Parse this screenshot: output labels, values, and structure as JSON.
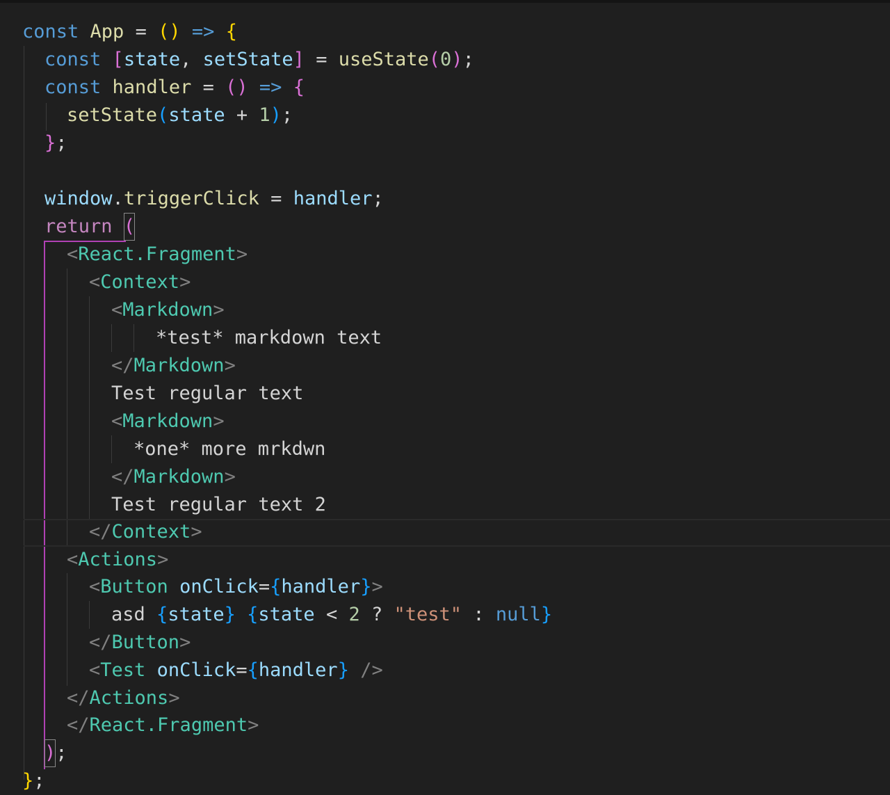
{
  "editor": {
    "language": "javascript-react",
    "theme": "dark",
    "lines": [
      "const App = () => {",
      "  const [state, setState] = useState(0);",
      "  const handler = () => {",
      "    setState(state + 1);",
      "  };",
      "",
      "  window.triggerClick = handler;",
      "  return (",
      "    <React.Fragment>",
      "      <Context>",
      "        <Markdown>",
      "            *test* markdown text",
      "        </Markdown>",
      "        Test regular text",
      "        <Markdown>",
      "          *one* more mrkdwn",
      "        </Markdown>",
      "        Test regular text 2",
      "      </Context>",
      "    <Actions>",
      "      <Button onClick={handler}>",
      "        asd {state} {state < 2 ? \"test\" : null}",
      "      </Button>",
      "      <Test onClick={handler} />",
      "    </Actions>",
      "    </React.Fragment>",
      "  );",
      "};"
    ]
  },
  "tokens": {
    "const": "const",
    "return": "return",
    "null": "null",
    "App": "App",
    "handler": "handler",
    "state": "state",
    "setState": "setState",
    "useState": "useState",
    "zero": "0",
    "one": "1",
    "two": "2",
    "window": "window",
    "triggerClick": "triggerClick",
    "ReactFragment": "React.Fragment",
    "Context": "Context",
    "Markdown": "Markdown",
    "Actions": "Actions",
    "Button": "Button",
    "Test": "Test",
    "onClick": "onClick",
    "testString": "\"test\"",
    "markdownText1": "*test* markdown text",
    "regularText1": "Test regular text",
    "markdownText2": "*one* more mrkdwn",
    "regularText2": "Test regular text 2",
    "asd": "asd"
  },
  "colors": {
    "background": "#1f1f1f",
    "keyword": "#569cd6",
    "control": "#c586c0",
    "function": "#dcdcaa",
    "variable": "#9cdcfe",
    "number": "#b5cea8",
    "string": "#ce9178",
    "tag": "#4ec9b0",
    "bracket_gold": "#ffd700",
    "bracket_orchid": "#da70d6",
    "bracket_blue": "#179fff"
  }
}
